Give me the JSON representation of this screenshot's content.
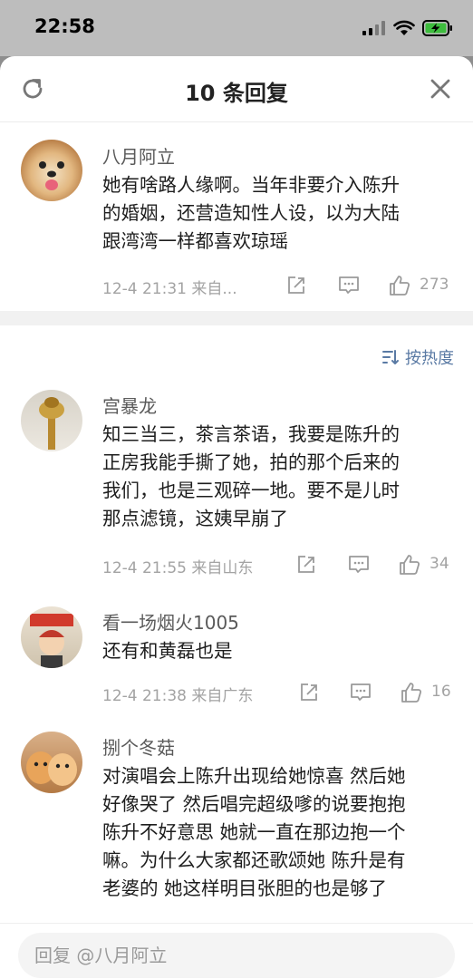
{
  "status": {
    "time": "22:58"
  },
  "header": {
    "title": "10 条回复"
  },
  "sort": {
    "label": "按热度"
  },
  "comments": [
    {
      "user": "八月阿立",
      "lines": [
        "她有啥路人缘啊。当年非要介入陈升",
        "的婚姻，还营造知性人设，以为大陆",
        "跟湾湾一样都喜欢琼瑶"
      ],
      "time": "12-4 21:31 来自...",
      "likes": "273"
    },
    {
      "user": "宫暴龙",
      "lines": [
        "知三当三，茶言茶语，我要是陈升的",
        "正房我能手撕了她，拍的那个后来的",
        "我们，也是三观碎一地。要不是儿时",
        "那点滤镜，这姨早崩了"
      ],
      "time": "12-4 21:55 来自山东",
      "likes": "34"
    },
    {
      "user": "看一场烟火1005",
      "lines": [
        "还有和黄磊也是"
      ],
      "time": "12-4 21:38 来自广东",
      "likes": "16"
    },
    {
      "user": "捌个冬菇",
      "lines": [
        "对演唱会上陈升出现给她惊喜 然后她",
        "好像哭了 然后唱完超级嗲的说要抱抱",
        "陈升不好意思 她就一直在那边抱一个",
        "嘛。为什么大家都还歌颂她 陈升是有",
        "老婆的 她这样明目张胆的也是够了"
      ]
    }
  ],
  "reply": {
    "placeholder": "回复 @八月阿立"
  }
}
